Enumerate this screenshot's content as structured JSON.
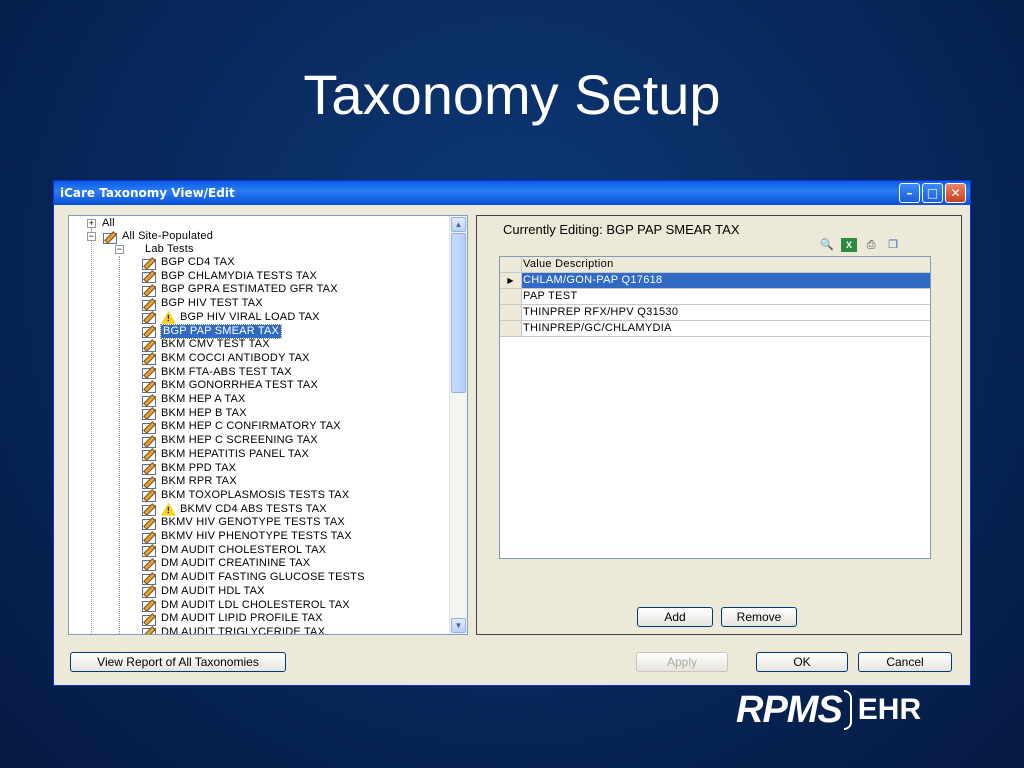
{
  "slide": {
    "title": "Taxonomy Setup"
  },
  "window": {
    "title": "iCare Taxonomy View/Edit"
  },
  "tree": {
    "root": "All",
    "site_populated": "All Site-Populated",
    "lab_tests": "Lab Tests",
    "items": [
      {
        "label": "BGP CD4 TAX",
        "icon": "pencil-icon"
      },
      {
        "label": "BGP CHLAMYDIA TESTS TAX",
        "icon": "pencil-icon"
      },
      {
        "label": "BGP GPRA ESTIMATED GFR TAX",
        "icon": "pencil-icon"
      },
      {
        "label": "BGP HIV TEST TAX",
        "icon": "pencil-icon"
      },
      {
        "label": "BGP HIV VIRAL LOAD TAX",
        "icon": "warning-icon"
      },
      {
        "label": "BGP PAP SMEAR TAX",
        "icon": "pencil-icon",
        "selected": true
      },
      {
        "label": "BKM CMV TEST TAX",
        "icon": "pencil-icon"
      },
      {
        "label": "BKM COCCI ANTIBODY TAX",
        "icon": "pencil-icon"
      },
      {
        "label": "BKM FTA-ABS TEST TAX",
        "icon": "pencil-icon"
      },
      {
        "label": "BKM GONORRHEA TEST TAX",
        "icon": "pencil-icon"
      },
      {
        "label": "BKM HEP A TAX",
        "icon": "pencil-icon"
      },
      {
        "label": "BKM HEP B TAX",
        "icon": "pencil-icon"
      },
      {
        "label": "BKM HEP C CONFIRMATORY TAX",
        "icon": "pencil-icon"
      },
      {
        "label": "BKM HEP C SCREENING TAX",
        "icon": "pencil-icon"
      },
      {
        "label": "BKM HEPATITIS PANEL TAX",
        "icon": "pencil-icon"
      },
      {
        "label": "BKM PPD TAX",
        "icon": "pencil-icon"
      },
      {
        "label": "BKM RPR TAX",
        "icon": "pencil-icon"
      },
      {
        "label": "BKM TOXOPLASMOSIS TESTS TAX",
        "icon": "pencil-icon"
      },
      {
        "label": "BKMV CD4 ABS TESTS TAX",
        "icon": "warning-icon"
      },
      {
        "label": "BKMV HIV GENOTYPE TESTS TAX",
        "icon": "pencil-icon"
      },
      {
        "label": "BKMV HIV PHENOTYPE TESTS TAX",
        "icon": "pencil-icon"
      },
      {
        "label": "DM AUDIT CHOLESTEROL TAX",
        "icon": "pencil-icon"
      },
      {
        "label": "DM AUDIT CREATININE TAX",
        "icon": "pencil-icon"
      },
      {
        "label": "DM AUDIT FASTING GLUCOSE TESTS",
        "icon": "pencil-icon"
      },
      {
        "label": "DM AUDIT HDL TAX",
        "icon": "pencil-icon"
      },
      {
        "label": "DM AUDIT LDL CHOLESTEROL TAX",
        "icon": "pencil-icon"
      },
      {
        "label": "DM AUDIT LIPID PROFILE TAX",
        "icon": "pencil-icon"
      },
      {
        "label": "DM AUDIT TRIGLYCERIDE TAX",
        "icon": "pencil-icon"
      }
    ]
  },
  "editor": {
    "label": "Currently Editing: BGP PAP SMEAR TAX",
    "column_header": "Value Description",
    "rows": [
      {
        "value": "CHLAM/GON-PAP Q17618",
        "selected": true
      },
      {
        "value": "PAP TEST"
      },
      {
        "value": "THINPREP RFX/HPV Q31530"
      },
      {
        "value": "THINPREP/GC/CHLAMYDIA"
      }
    ],
    "add_label": "Add",
    "remove_label": "Remove",
    "toolbar_icons": [
      "find-icon",
      "excel-icon",
      "print-icon",
      "copy-icon"
    ]
  },
  "footer": {
    "report_label": "View Report of All Taxonomies",
    "apply_label": "Apply",
    "ok_label": "OK",
    "cancel_label": "Cancel"
  },
  "logo": {
    "rpms": "RPMS",
    "ehr": "EHR"
  }
}
